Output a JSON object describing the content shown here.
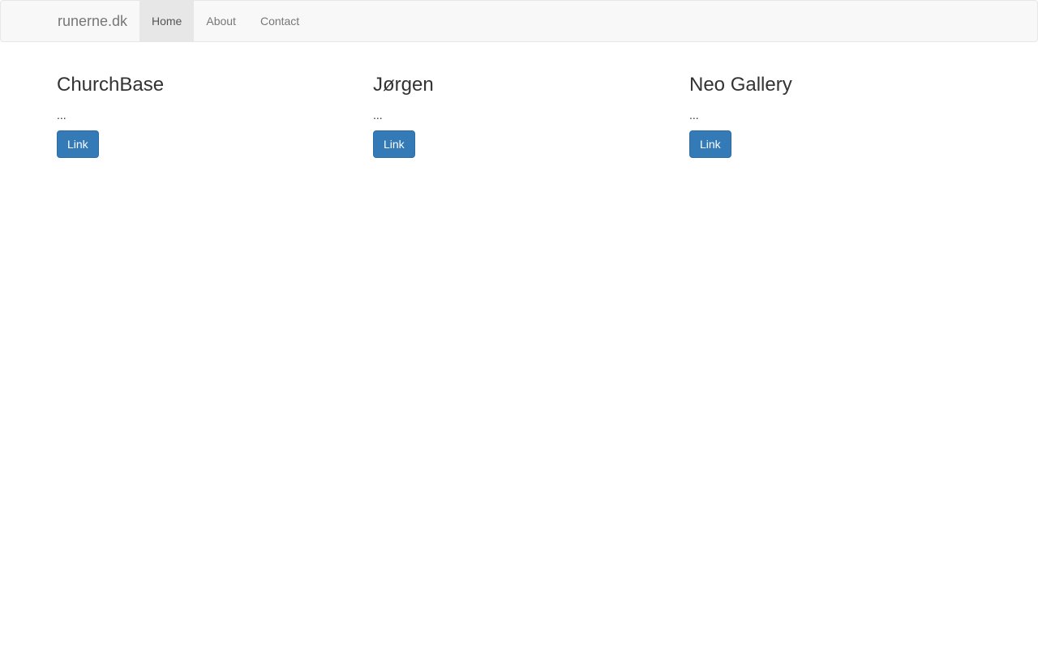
{
  "navbar": {
    "brand": "runerne.dk",
    "items": [
      {
        "label": "Home",
        "active": true
      },
      {
        "label": "About",
        "active": false
      },
      {
        "label": "Contact",
        "active": false
      }
    ]
  },
  "columns": [
    {
      "title": "ChurchBase",
      "text": "...",
      "button": "Link"
    },
    {
      "title": "Jørgen",
      "text": "...",
      "button": "Link"
    },
    {
      "title": "Neo Gallery",
      "text": "...",
      "button": "Link"
    }
  ],
  "colors": {
    "primary": "#337ab7",
    "navbar_bg": "#f8f8f8",
    "nav_active_bg": "#e7e7e7"
  }
}
